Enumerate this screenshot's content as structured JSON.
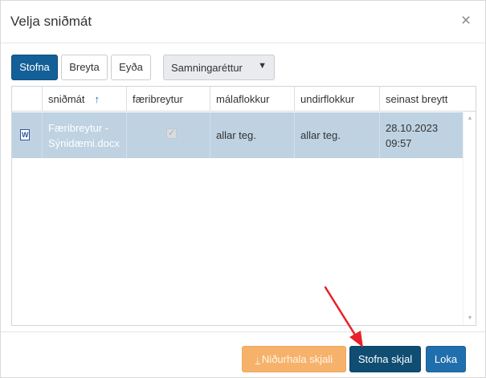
{
  "dialog": {
    "title": "Velja sniðmát",
    "close_symbol": "×"
  },
  "toolbar": {
    "create_label": "Stofna",
    "edit_label": "Breyta",
    "delete_label": "Eyða",
    "category_select": {
      "selected": "Samningaréttur",
      "caret": "▼"
    }
  },
  "grid": {
    "columns": [
      {
        "label": "sniðmát",
        "sort_symbol": "↑"
      },
      {
        "label": "færibreytur"
      },
      {
        "label": "málaflokkur"
      },
      {
        "label": "undirflokkur"
      },
      {
        "label": "seinast breytt"
      }
    ],
    "rows": [
      {
        "file_icon": "word-document-icon",
        "file_icon_letter": "W",
        "name": "Færibreytur - Sýnidæmi.docx",
        "parameters_checked": true,
        "check_mark": "✓",
        "case_category": "allar teg.",
        "subcategory": "allar teg.",
        "last_modified": "28.10.2023 09:57"
      }
    ],
    "scroll_up_symbol": "▲",
    "scroll_down_symbol": "▼"
  },
  "footer": {
    "download_icon": "download-icon",
    "download_symbol": "↓",
    "download_label": "Niðurhala skjali",
    "create_document_label": "Stofna skjal",
    "close_label": "Loka"
  },
  "colors": {
    "primary": "#135f98",
    "selected_row": "#bed2e2",
    "download_button": "#f6b26b",
    "create_document_button": "#0f4d72",
    "close_button": "#1f6fae",
    "annotation_arrow": "#e8202a"
  }
}
